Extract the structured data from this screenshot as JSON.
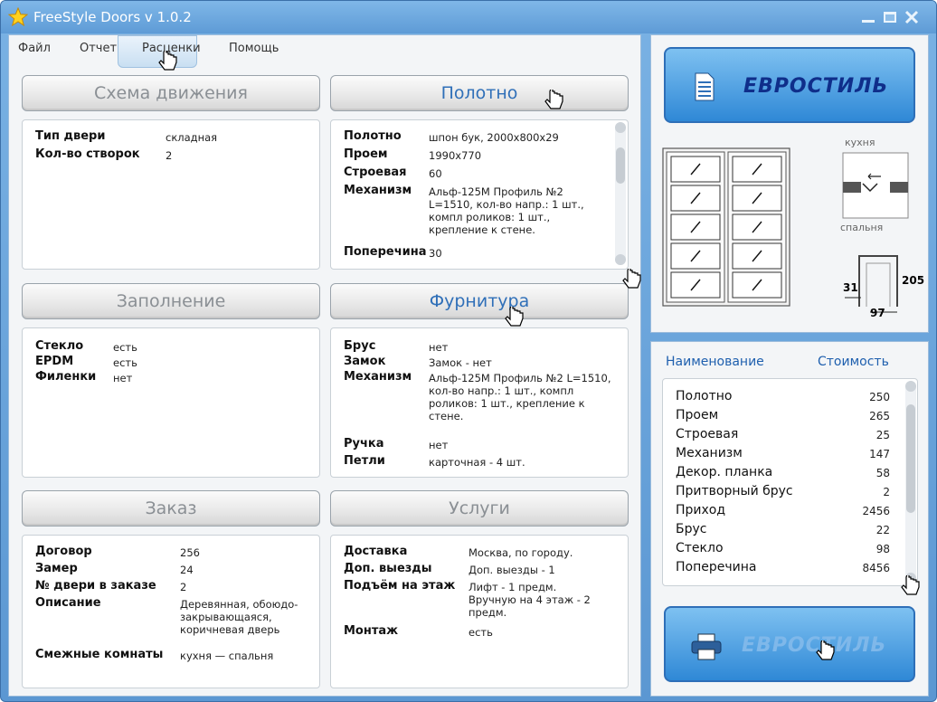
{
  "window": {
    "title": "FreeStyle Doors v 1.0.2"
  },
  "menu": {
    "items": [
      "Файл",
      "Отчет",
      "Расценки",
      "Помощь"
    ]
  },
  "sections": {
    "movement": {
      "title": "Схема движения",
      "rows": [
        {
          "label": "Тип двери",
          "value": "складная"
        },
        {
          "label": "Кол-во створок",
          "value": "2"
        }
      ]
    },
    "leaf": {
      "title": "Полотно",
      "rows": [
        {
          "label": "Полотно",
          "value": "шпон бук, 2000x800x29"
        },
        {
          "label": "Проем",
          "value": "1990x770"
        },
        {
          "label": "Строевая",
          "value": "60"
        },
        {
          "label": "Механизм",
          "value": "Альф-125М Профиль №2 L=1510, кол-во напр.: 1 шт., компл роликов: 1 шт., крепление к стене."
        },
        {
          "label": "Поперечина",
          "value": "30"
        }
      ]
    },
    "filling": {
      "title": "Заполнение",
      "rows": [
        {
          "label": "Стекло",
          "value": "есть"
        },
        {
          "label": "EPDM",
          "value": "есть"
        },
        {
          "label": "Филенки",
          "value": "нет"
        }
      ]
    },
    "hardware": {
      "title": "Фурнитура",
      "rows": [
        {
          "label": "Брус",
          "value": "нет"
        },
        {
          "label": "Замок",
          "value": "Замок - нет"
        },
        {
          "label": "Механизм",
          "value": "Альф-125М Профиль №2 L=1510, кол-во напр.: 1 шт., компл роликов: 1 шт., крепление к стене."
        },
        {
          "label": "Ручка",
          "value": "нет"
        },
        {
          "label": "Петли",
          "value": "карточная - 4 шт."
        }
      ]
    },
    "order": {
      "title": "Заказ",
      "rows": [
        {
          "label": "Договор",
          "value": "256"
        },
        {
          "label": "Замер",
          "value": "24"
        },
        {
          "label": "№ двери в заказе",
          "value": "2"
        },
        {
          "label": "Описание",
          "value": "Деревянная, обоюдо-закрывающаяся, коричневая дверь"
        },
        {
          "label": "Смежные комнаты",
          "value": "кухня — спальня"
        }
      ]
    },
    "services": {
      "title": "Услуги",
      "rows": [
        {
          "label": "Доставка",
          "value": "Москва, по городу."
        },
        {
          "label": "Доп. выезды",
          "value": "Доп. выезды - 1"
        },
        {
          "label": "Подъём на этаж",
          "value": "Лифт - 1 предм. Вручную на 4 этаж - 2 предм."
        },
        {
          "label": "Монтаж",
          "value": "есть"
        }
      ]
    }
  },
  "brand": {
    "logo_text": "ЕВРОСТИЛЬ"
  },
  "diagram": {
    "room_top": "кухня",
    "room_bottom": "спальня",
    "dim_left": "31",
    "dim_right": "205",
    "dim_bottom": "97"
  },
  "price": {
    "header_name": "Наименование",
    "header_cost": "Стоимость",
    "items": [
      {
        "name": "Полотно",
        "cost": "250"
      },
      {
        "name": "Проем",
        "cost": "265"
      },
      {
        "name": "Строевая",
        "cost": "25"
      },
      {
        "name": "Механизм",
        "cost": "147"
      },
      {
        "name": "Декор. планка",
        "cost": "58"
      },
      {
        "name": "Притворный брус",
        "cost": "2"
      },
      {
        "name": "Приход",
        "cost": "2456"
      },
      {
        "name": "Брус",
        "cost": "22"
      },
      {
        "name": "Стекло",
        "cost": "98"
      },
      {
        "name": "Поперечина",
        "cost": "8456"
      }
    ]
  },
  "colors": {
    "accent": "#2f6fb8",
    "title_bar": "#5e9bd6",
    "logo_text": "#0f2e8a"
  }
}
